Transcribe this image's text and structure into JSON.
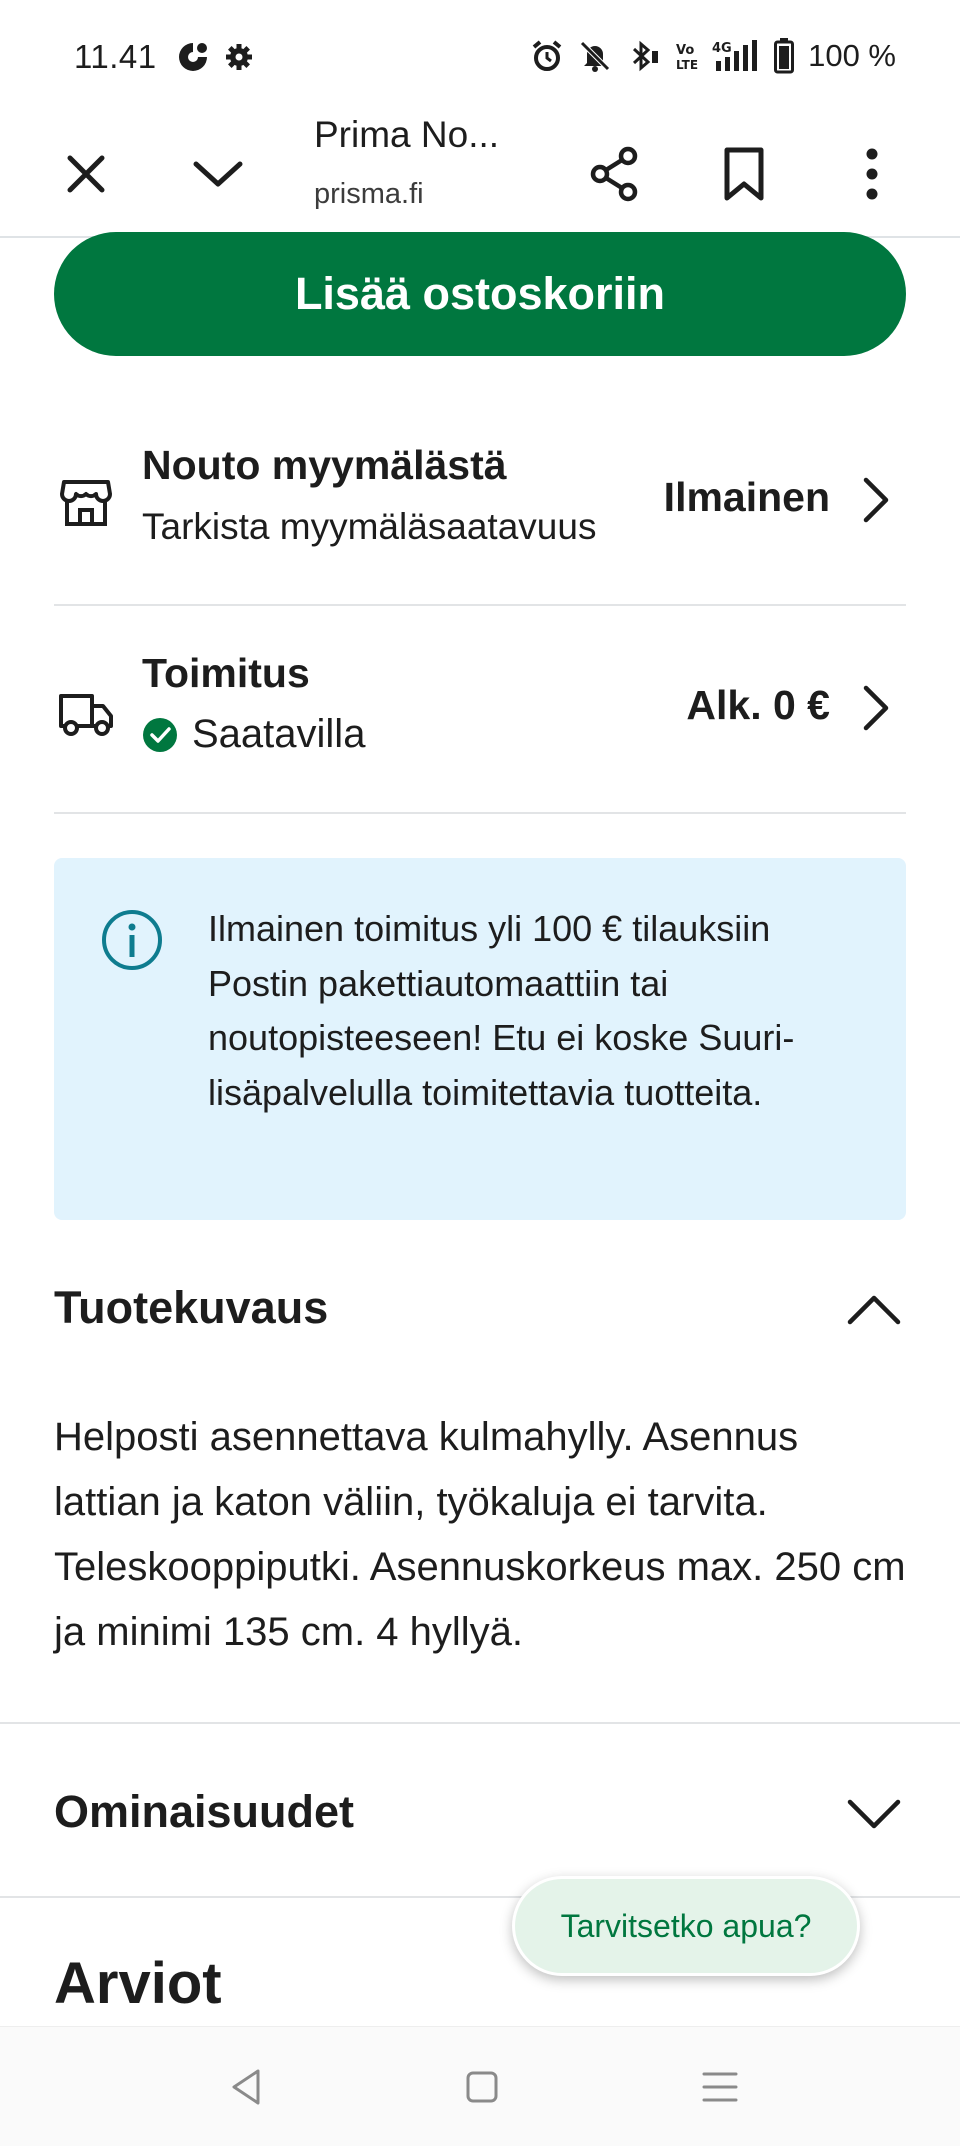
{
  "status_bar": {
    "time": "11.41",
    "battery": "100 %",
    "left_icons": [
      "c-app-icon",
      "gear-icon"
    ],
    "right_icons": [
      "alarm-icon",
      "mute-icon",
      "bluetooth-icon",
      "volte-icon",
      "signal-4g-icon",
      "battery-icon"
    ]
  },
  "browser": {
    "page_title": "Prima No...",
    "url": "prisma.fi"
  },
  "cta": {
    "label": "Lisää ostoskoriin"
  },
  "pickup": {
    "title": "Nouto myymälästä",
    "subtitle": "Tarkista myymäläsaatavuus",
    "price": "Ilmainen"
  },
  "delivery": {
    "title": "Toimitus",
    "status": "Saatavilla",
    "price": "Alk. 0 €"
  },
  "info": {
    "text": "Ilmainen toimitus yli 100 € tilauksiin Postin pakettiautomaattiin tai noutopisteeseen! Etu ei koske Suuri-lisäpalvelulla toimitettavia tuotteita."
  },
  "description": {
    "title": "Tuotekuvaus",
    "text": "Helposti asennettava kulmahylly. Asennus lattian ja katon väliin, työkaluja ei tarvita. Teleskooppiputki. Asennuskorkeus max. 250 cm ja minimi 135 cm. 4 hyllyä.",
    "expanded": true
  },
  "features": {
    "title": "Ominaisuudet",
    "expanded": false
  },
  "reviews": {
    "title": "Arviot"
  },
  "help_button": {
    "label": "Tarvitsetko apua?"
  },
  "colors": {
    "primary_green": "#00773f",
    "info_bg": "#e1f3fd",
    "info_icon": "#0e7c8f",
    "help_bg": "#e4f3e9"
  }
}
